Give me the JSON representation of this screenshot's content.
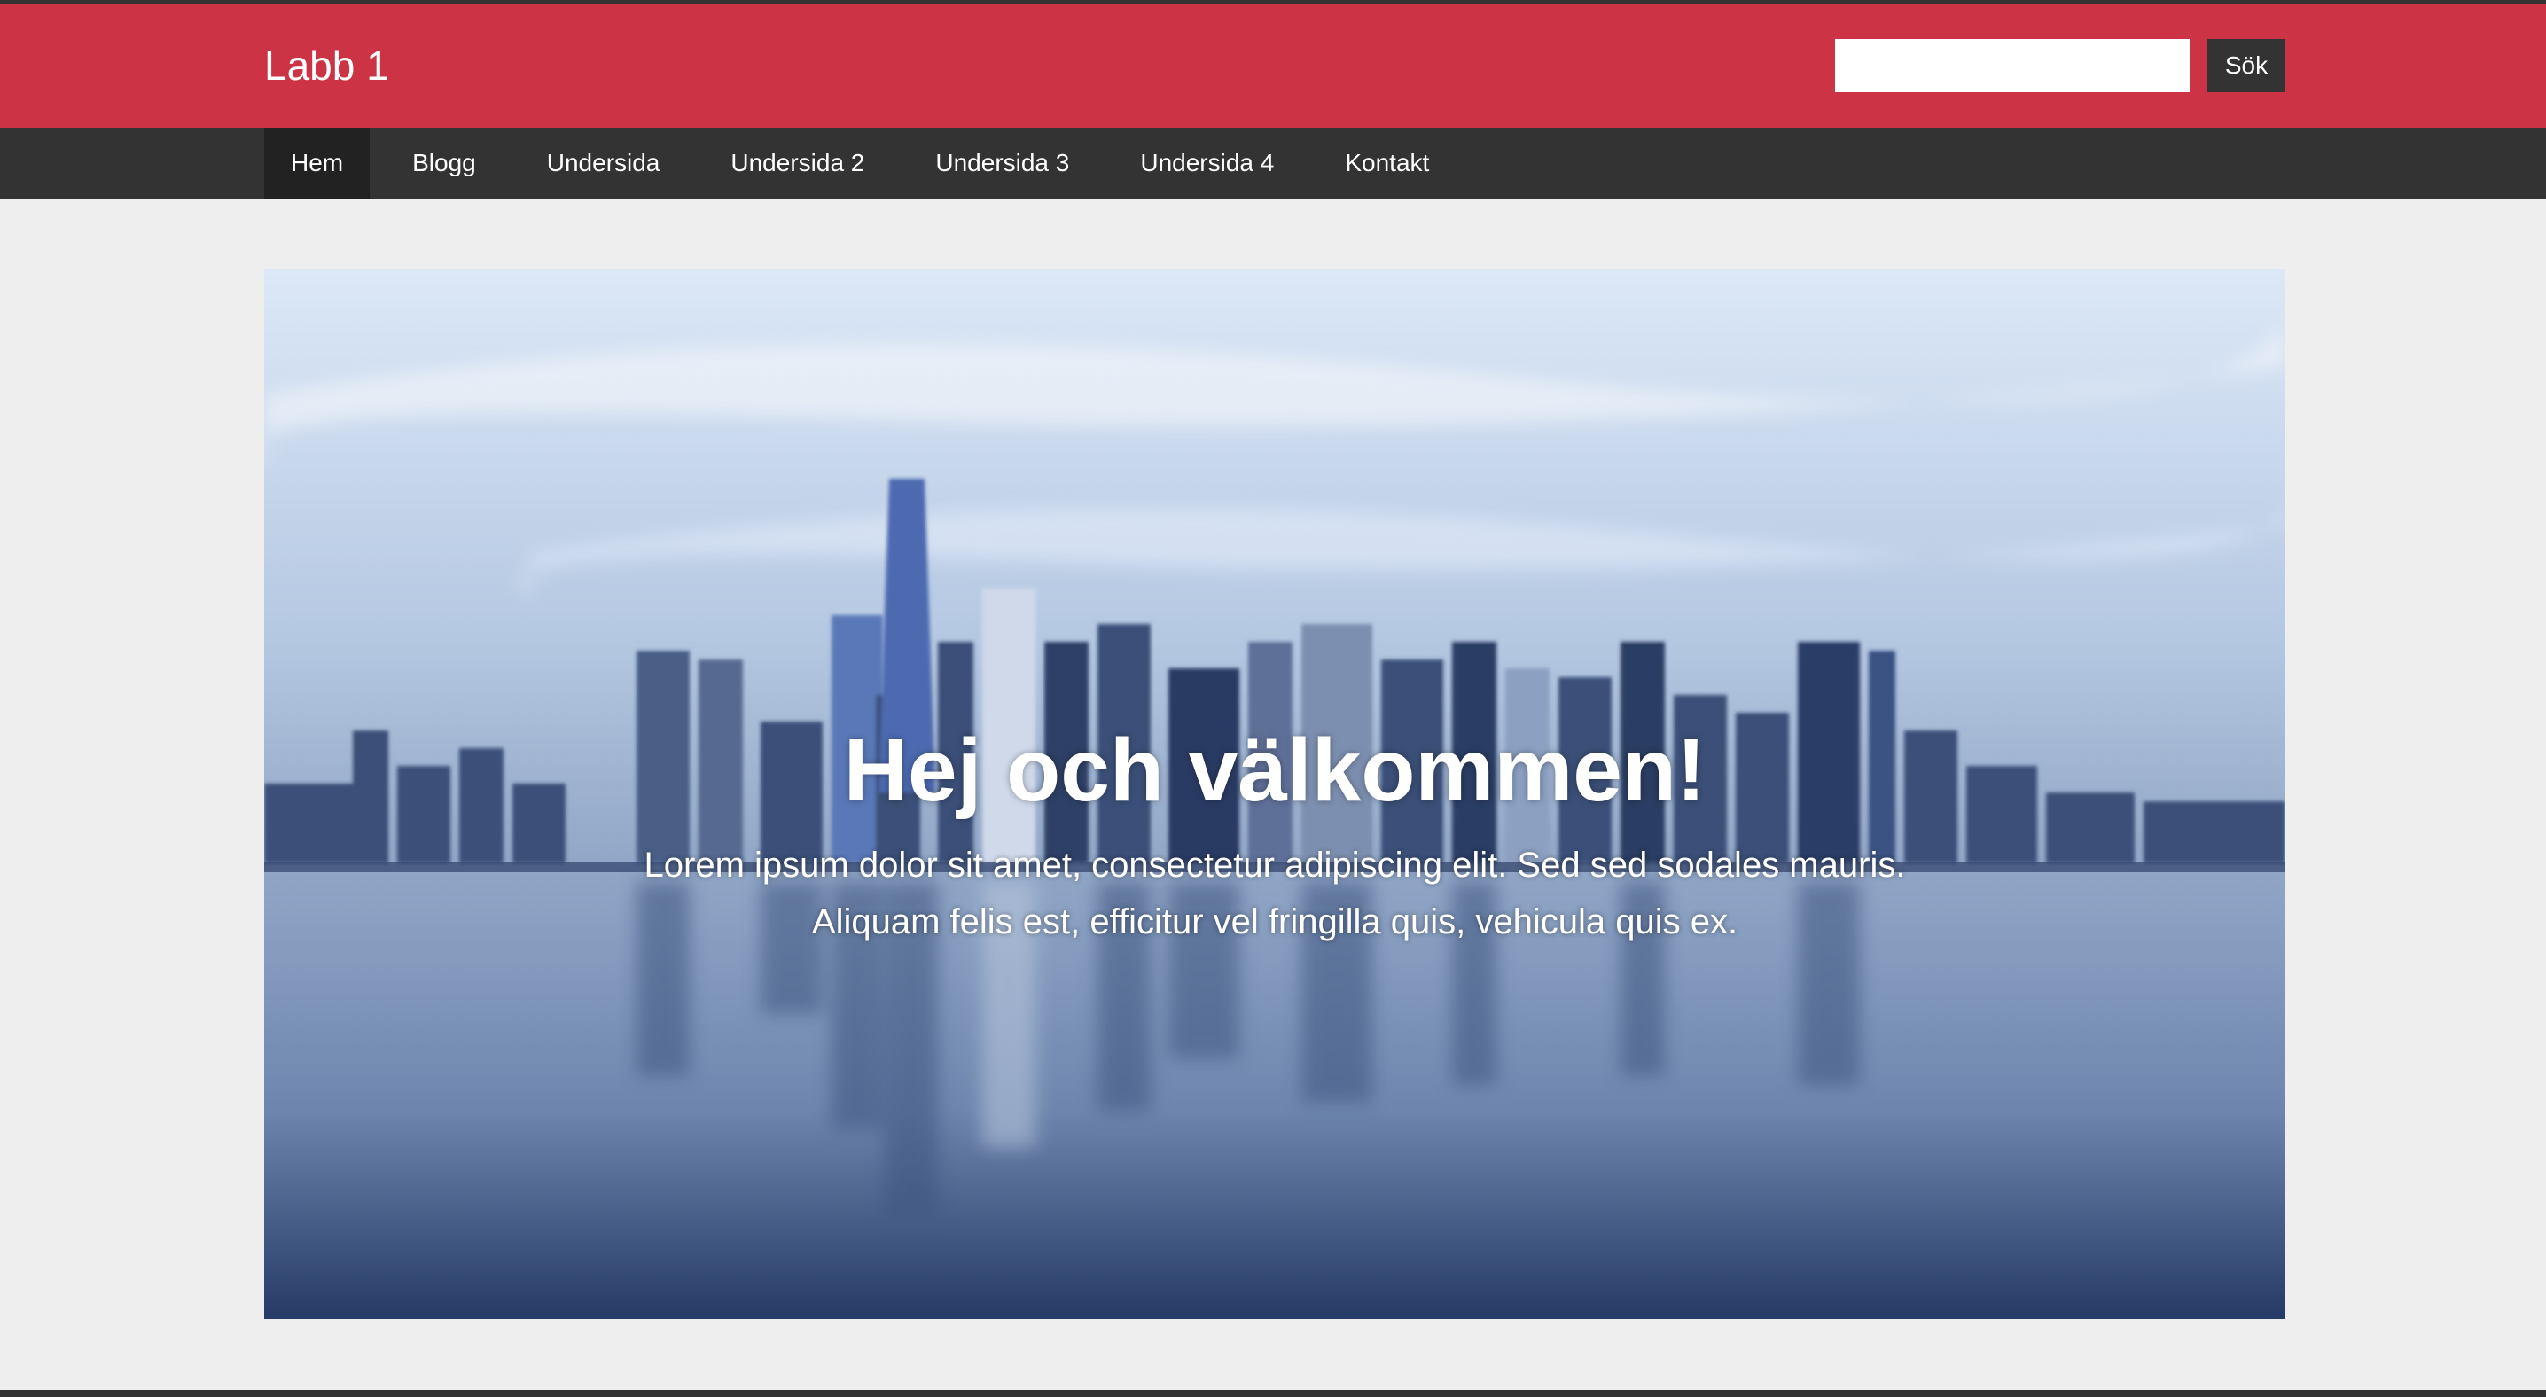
{
  "header": {
    "site_title": "Labb 1",
    "search_placeholder": "",
    "search_button_label": "Sök",
    "accent_color": "#cc3344"
  },
  "nav": {
    "items": [
      {
        "label": "Hem",
        "active": true
      },
      {
        "label": "Blogg"
      },
      {
        "label": "Undersida"
      },
      {
        "label": "Undersida 2"
      },
      {
        "label": "Undersida 3"
      },
      {
        "label": "Undersida 4"
      },
      {
        "label": "Kontakt"
      }
    ]
  },
  "hero": {
    "title": "Hej och välkommen!",
    "lead": "Lorem ipsum dolor sit amet, consectetur adipiscing elit. Sed sed sodales mauris. Aliquam felis est, efficitur vel fringilla quis, vehicula quis ex."
  }
}
